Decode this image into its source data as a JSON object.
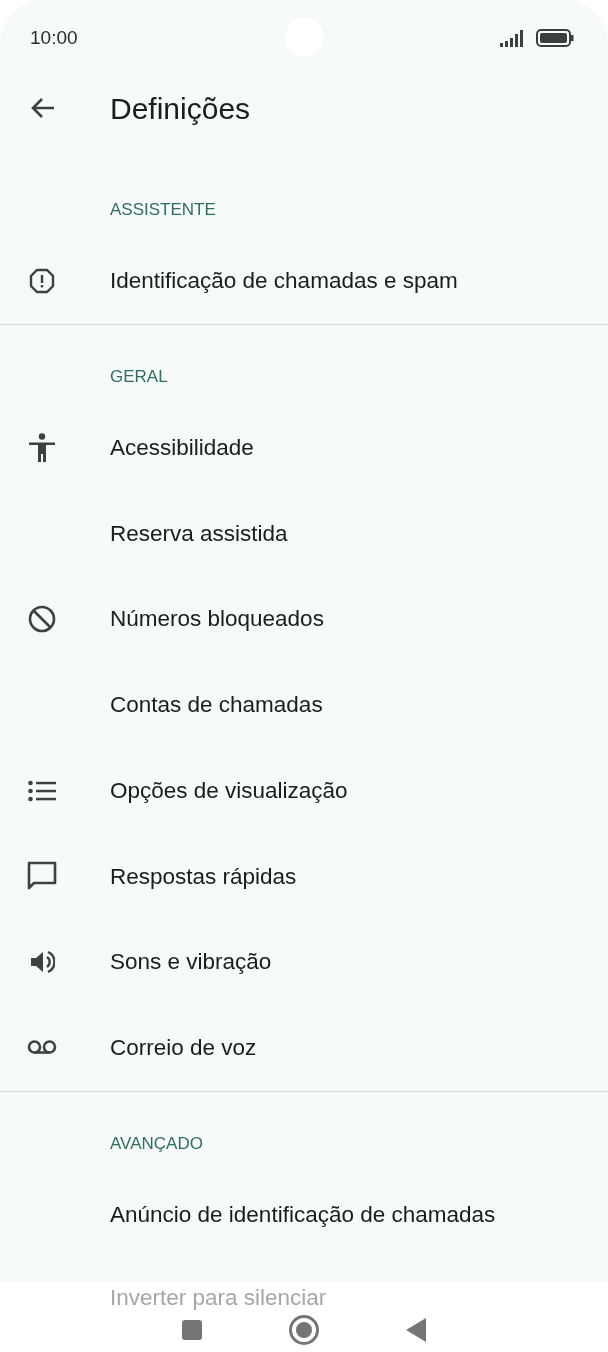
{
  "status_bar": {
    "time": "10:00"
  },
  "app_bar": {
    "title": "Definições"
  },
  "sections": [
    {
      "header": "ASSISTENTE",
      "items": [
        {
          "label": "Identificação de chamadas e spam"
        }
      ]
    },
    {
      "header": "GERAL",
      "items": [
        {
          "label": "Acessibilidade"
        },
        {
          "label": "Reserva assistida"
        },
        {
          "label": "Números bloqueados"
        },
        {
          "label": "Contas de chamadas"
        },
        {
          "label": "Opções de visualização"
        },
        {
          "label": "Respostas rápidas"
        },
        {
          "label": "Sons e vibração"
        },
        {
          "label": "Correio de voz"
        }
      ]
    },
    {
      "header": "AVANÇADO",
      "items": [
        {
          "label": "Anúncio de identificação de chamadas"
        },
        {
          "label": "Inverter para silenciar",
          "faded": true
        }
      ]
    }
  ]
}
